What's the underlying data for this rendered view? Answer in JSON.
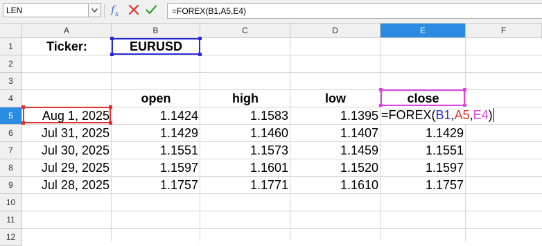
{
  "name_box": "LEN",
  "formula_bar": {
    "value": "=FOREX(B1,A5,E4)"
  },
  "columns": [
    "A",
    "B",
    "C",
    "D",
    "E",
    "F"
  ],
  "rows": [
    "1",
    "2",
    "3",
    "4",
    "5",
    "6",
    "7",
    "8",
    "9",
    "10",
    "11",
    "12"
  ],
  "cells": {
    "A1": "Ticker:",
    "B1": "EURUSD",
    "B4": "open",
    "C4": "high",
    "D4": "low",
    "E4": "close",
    "A5": "Aug 1, 2025",
    "B5": "1.1424",
    "C5": "1.1583",
    "D5": "1.1395",
    "A6": "Jul 31, 2025",
    "B6": "1.1429",
    "C6": "1.1460",
    "D6": "1.1407",
    "E6": "1.1429",
    "A7": "Jul 30, 2025",
    "B7": "1.1551",
    "C7": "1.1573",
    "D7": "1.1459",
    "E7": "1.1551",
    "A8": "Jul 29, 2025",
    "B8": "1.1597",
    "C8": "1.1601",
    "D8": "1.1520",
    "E8": "1.1597",
    "A9": "Jul 28, 2025",
    "B9": "1.1757",
    "C9": "1.1771",
    "D9": "1.1610",
    "E9": "1.1757"
  },
  "edit_cell": {
    "prefix": "=FOREX(",
    "ref1": "B1",
    "sep1": ",",
    "ref2": "A5",
    "sep2": ",",
    "ref3": "E4",
    "suffix": ")"
  },
  "colors": {
    "ref_b1": "#2b2bd6",
    "ref_a5": "#e03030",
    "ref_e4": "#e040e0",
    "selection": "#2a8be0"
  },
  "icons": [
    "chevron-down-icon",
    "function-wizard-icon",
    "cancel-icon",
    "accept-icon"
  ]
}
